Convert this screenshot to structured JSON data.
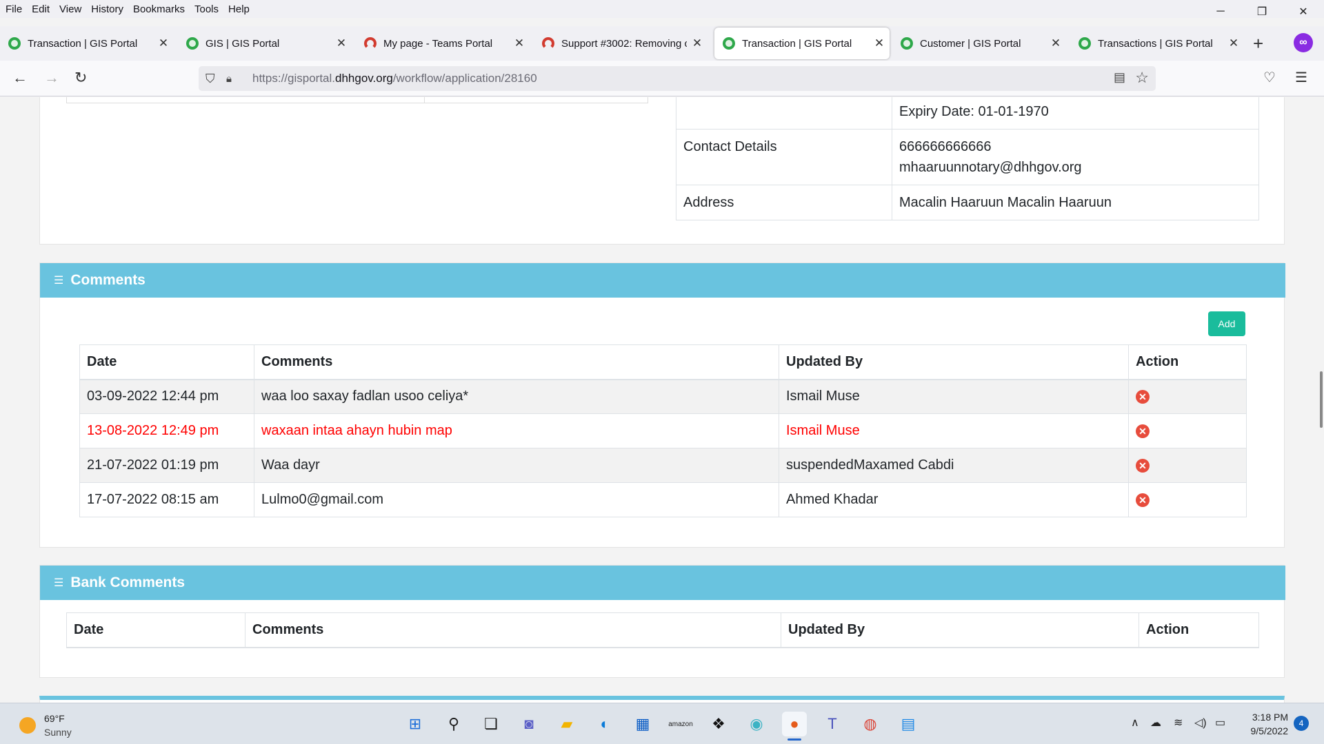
{
  "menu": [
    "File",
    "Edit",
    "View",
    "History",
    "Bookmarks",
    "Tools",
    "Help"
  ],
  "tabs": [
    {
      "title": "Transaction | GIS Portal",
      "icon": "gis-portal-favicon",
      "active": false
    },
    {
      "title": "GIS | GIS Portal",
      "icon": "gis-portal-favicon",
      "active": false
    },
    {
      "title": "My page - Teams Portal",
      "icon": "teams-portal-favicon",
      "active": false
    },
    {
      "title": "Support #3002: Removing co",
      "icon": "teams-portal-favicon",
      "active": false
    },
    {
      "title": "Transaction | GIS Portal",
      "icon": "gis-portal-favicon",
      "active": true
    },
    {
      "title": "Customer | GIS Portal",
      "icon": "gis-portal-favicon",
      "active": false
    },
    {
      "title": "Transactions | GIS Portal",
      "icon": "gis-portal-favicon",
      "active": false
    }
  ],
  "address": {
    "prefix": "https://gisportal.",
    "domain": "dhhgov.org",
    "path": "/workflow/application/28160"
  },
  "info": {
    "expiry": "Expiry Date: 01-01-1970",
    "contact_label": "Contact Details",
    "contact_phone": "666666666666",
    "contact_email": "mhaaruunnotary@dhhgov.org",
    "address_label": "Address",
    "address_value": "Macalin Haaruun Macalin Haaruun"
  },
  "comments": {
    "title": "Comments",
    "add_label": "Add",
    "headers": [
      "Date",
      "Comments",
      "Updated By",
      "Action"
    ],
    "rows": [
      {
        "date": "03-09-2022 12:44 pm",
        "comment": "waa loo saxay fadlan usoo celiya*",
        "by": "Ismail Muse",
        "highlight": false
      },
      {
        "date": "13-08-2022 12:49 pm",
        "comment": "waxaan intaa ahayn hubin map",
        "by": "Ismail Muse",
        "highlight": true
      },
      {
        "date": "21-07-2022 01:19 pm",
        "comment": "Waa dayr",
        "by": "suspendedMaxamed Cabdi",
        "highlight": false
      },
      {
        "date": "17-07-2022 08:15 am",
        "comment": "Lulmo0@gmail.com",
        "by": "Ahmed Khadar",
        "highlight": false
      }
    ]
  },
  "bank_comments": {
    "title": "Bank Comments",
    "headers": [
      "Date",
      "Comments",
      "Updated By",
      "Action"
    ]
  },
  "taskbar": {
    "temperature": "69°F",
    "condition": "Sunny",
    "time": "3:18 PM",
    "date": "9/5/2022",
    "notifications": "4"
  },
  "colors": {
    "section_header": "#69c3df",
    "add_button": "#1abc9c",
    "highlight_text": "#ff0000",
    "delete_icon": "#e74c3c"
  }
}
